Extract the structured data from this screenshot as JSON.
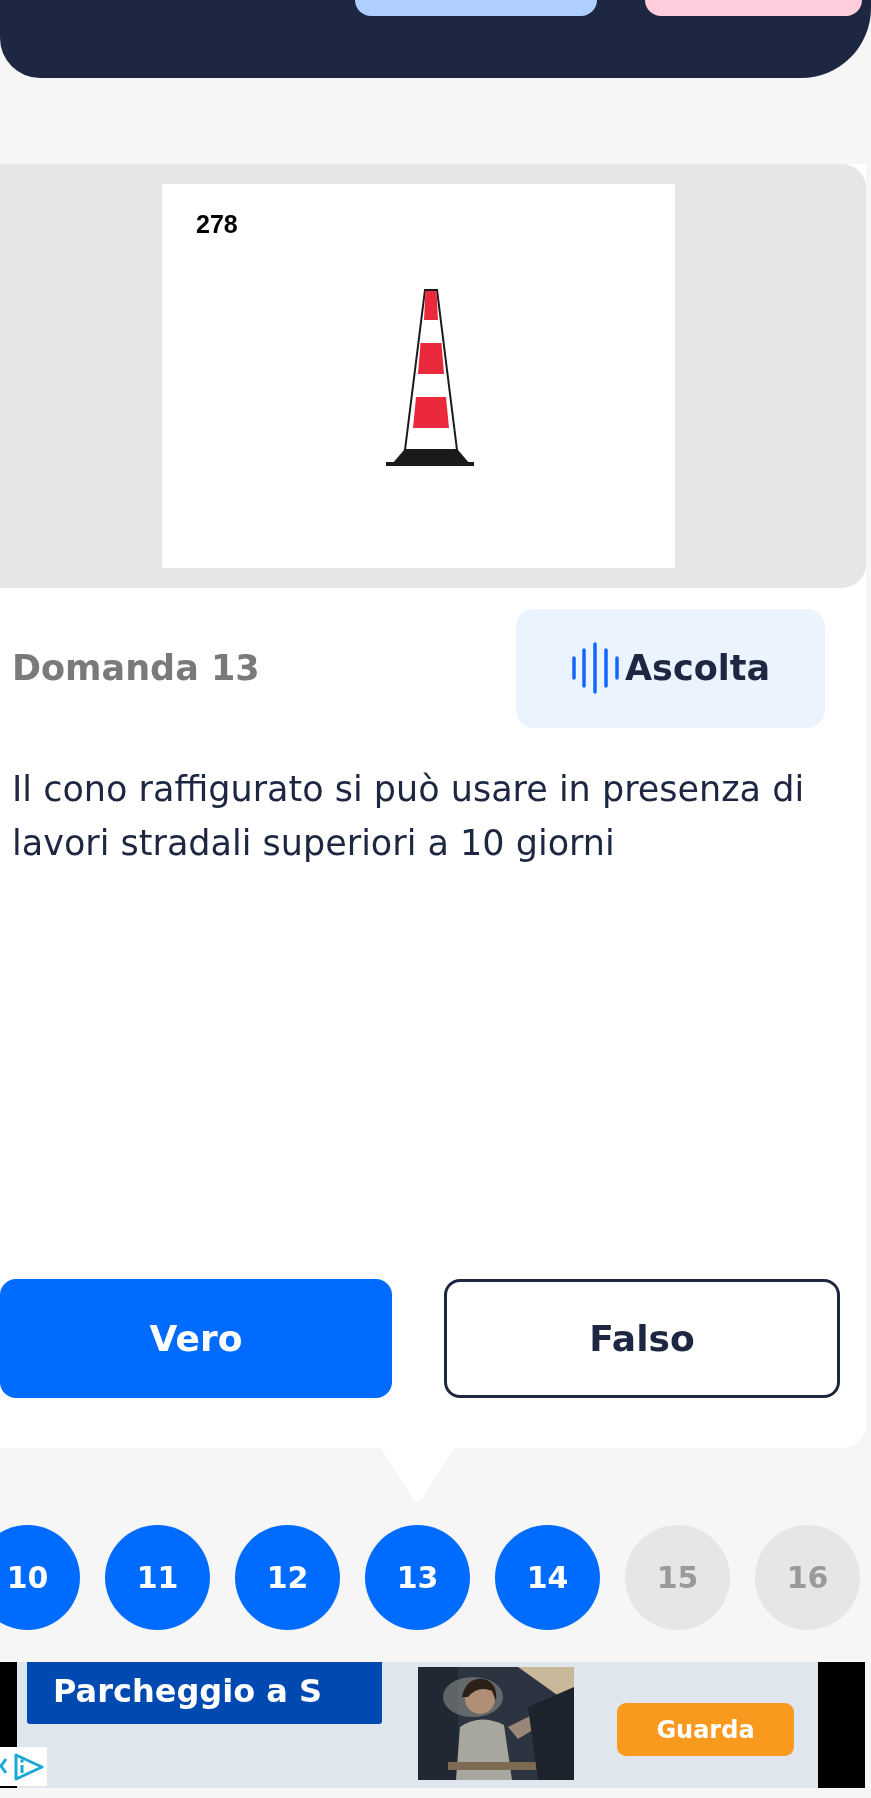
{
  "header": {
    "buttons": [
      {
        "color": "#aecfff"
      },
      {
        "color": "#ffcddb"
      }
    ]
  },
  "image": {
    "figure_number": "278"
  },
  "question": {
    "title": "Domanda 13",
    "listen_button": "Ascolta",
    "text": "Il cono raffigurato si può usare in presenza di lavori stradali superiori a 10 giorni"
  },
  "answers": [
    {
      "label": "Vero",
      "selected": true
    },
    {
      "label": "Falso",
      "selected": false
    }
  ],
  "navigator": [
    {
      "label": "10",
      "answered": true,
      "current": false
    },
    {
      "label": "11",
      "answered": true,
      "current": false
    },
    {
      "label": "12",
      "answered": true,
      "current": false
    },
    {
      "label": "13",
      "answered": true,
      "current": true
    },
    {
      "label": "14",
      "answered": true,
      "current": false
    },
    {
      "label": "15",
      "answered": false,
      "current": false
    },
    {
      "label": "16",
      "answered": false,
      "current": false
    }
  ],
  "ad": {
    "headline": "Parcheggio a S",
    "button": "Guarda"
  }
}
